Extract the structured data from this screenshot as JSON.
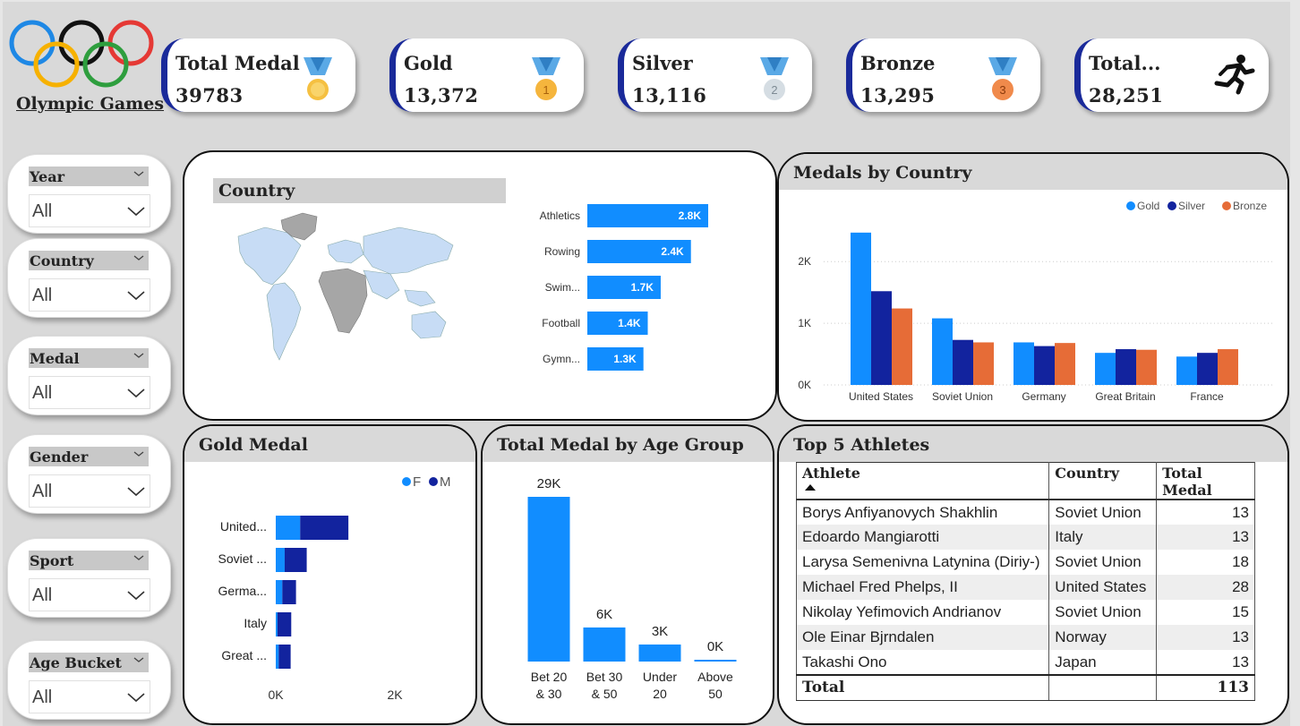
{
  "brand": {
    "title": "Olympic Games"
  },
  "kpis": [
    {
      "label": "Total Medal",
      "value": "39783",
      "icon": "gold-medal-icon"
    },
    {
      "label": "Gold",
      "value": "13,372",
      "icon": "gold-medal-1-icon",
      "badge": "1"
    },
    {
      "label": "Silver",
      "value": "13,116",
      "icon": "silver-medal-2-icon",
      "badge": "2"
    },
    {
      "label": "Bronze",
      "value": "13,295",
      "icon": "bronze-medal-3-icon",
      "badge": "3"
    },
    {
      "label": "Total...",
      "value": "28,251",
      "icon": "runner-icon"
    }
  ],
  "slicers": [
    {
      "label": "Year",
      "value": "All"
    },
    {
      "label": "Country",
      "value": "All"
    },
    {
      "label": "Medal",
      "value": "All"
    },
    {
      "label": "Gender",
      "value": "All"
    },
    {
      "label": "Sport",
      "value": "All"
    },
    {
      "label": "Age Bucket",
      "value": "All"
    }
  ],
  "panels": {
    "country": "Country",
    "medals_by_country": "Medals by Country",
    "gold_medal": "Gold Medal",
    "age_group": "Total Medal by Age Group",
    "top_athletes": "Top 5 Athletes"
  },
  "colors": {
    "gold": "#118dff",
    "silver": "#12239e",
    "bronze": "#e66c37",
    "bar": "#118dff",
    "accent": "#1a2a9a"
  },
  "chart_data": [
    {
      "type": "bar",
      "orientation": "horizontal",
      "categories": [
        "Athletics",
        "Rowing",
        "Swim...",
        "Football",
        "Gymn..."
      ],
      "values": [
        2.8,
        2.4,
        1.7,
        1.4,
        1.3
      ],
      "value_labels": [
        "2.8K",
        "2.4K",
        "1.7K",
        "1.4K",
        "1.3K"
      ]
    },
    {
      "type": "bar",
      "title": "Medals by Country",
      "categories": [
        "United States",
        "Soviet Union",
        "Germany",
        "Great Britain",
        "France"
      ],
      "series": [
        {
          "name": "Gold",
          "values": [
            2470,
            1080,
            690,
            520,
            460
          ]
        },
        {
          "name": "Silver",
          "values": [
            1520,
            730,
            630,
            580,
            520
          ]
        },
        {
          "name": "Bronze",
          "values": [
            1240,
            690,
            680,
            570,
            580
          ]
        }
      ],
      "ylim": [
        0,
        2700
      ],
      "yticks": [
        "0K",
        "1K",
        "2K"
      ],
      "legend": "top-right",
      "grid": true
    },
    {
      "type": "bar",
      "orientation": "horizontal",
      "stacked": true,
      "title": "Gold Medal",
      "categories": [
        "United...",
        "Soviet ...",
        "Germa...",
        "Italy",
        "Great ..."
      ],
      "series": [
        {
          "name": "F",
          "values": [
            410,
            150,
            110,
            30,
            50
          ]
        },
        {
          "name": "M",
          "values": [
            810,
            370,
            230,
            230,
            200
          ]
        }
      ],
      "xticks": [
        "0K",
        "2K"
      ],
      "xlim": [
        0,
        2000
      ],
      "legend": "top-right"
    },
    {
      "type": "bar",
      "title": "Total Medal by Age Group",
      "categories": [
        "Bet 20 & 30",
        "Bet 30 & 50",
        "Under 20",
        "Above 50"
      ],
      "category_lines": [
        [
          "Bet 20",
          "& 30"
        ],
        [
          "Bet 30",
          "& 50"
        ],
        [
          "Under",
          "20"
        ],
        [
          "Above",
          "50"
        ]
      ],
      "values": [
        29,
        6,
        3,
        0.1
      ],
      "value_labels": [
        "29K",
        "6K",
        "3K",
        "0K"
      ]
    }
  ],
  "athletes_table": {
    "headers": [
      "Athlete",
      "Country",
      "Total Medal"
    ],
    "rows": [
      [
        "Borys Anfiyanovych Shakhlin",
        "Soviet Union",
        "13"
      ],
      [
        "Edoardo Mangiarotti",
        "Italy",
        "13"
      ],
      [
        "Larysa Semenivna Latynina (Diriy-)",
        "Soviet Union",
        "18"
      ],
      [
        "Michael Fred Phelps, II",
        "United States",
        "28"
      ],
      [
        "Nikolay Yefimovich Andrianov",
        "Soviet Union",
        "15"
      ],
      [
        "Ole Einar Bjrndalen",
        "Norway",
        "13"
      ],
      [
        "Takashi Ono",
        "Japan",
        "13"
      ]
    ],
    "total_label": "Total",
    "total_value": "113"
  }
}
